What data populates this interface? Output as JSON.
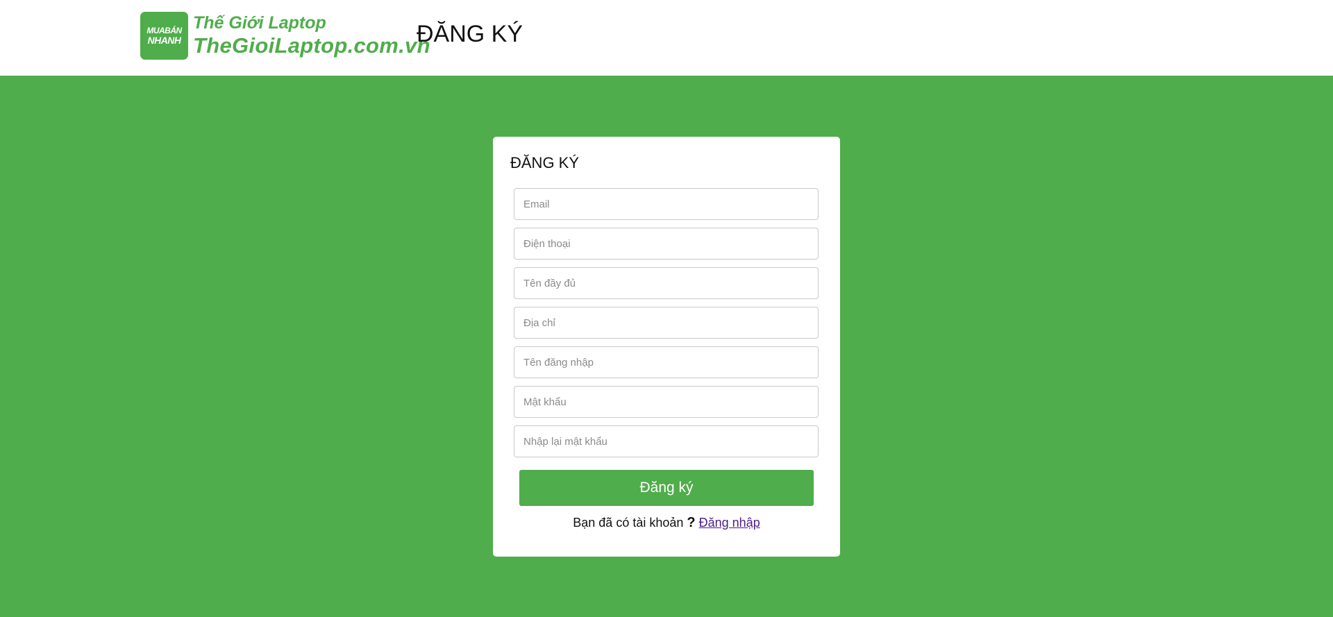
{
  "header": {
    "logo": {
      "badge_line1": "MUABÁN",
      "badge_line2": "NHANH",
      "line1": "Thế Giới Laptop",
      "line2": "TheGioiLaptop.com.vn"
    },
    "title": "ĐĂNG KÝ"
  },
  "form": {
    "title": "ĐĂNG KÝ",
    "fields": {
      "email": "Email",
      "phone": "Điện thoại",
      "fullname": "Tên đầy đủ",
      "address": "Địa chỉ",
      "username": "Tên đăng nhập",
      "password": "Mật khẩu",
      "confirm_password": "Nhập lại mật khẩu"
    },
    "submit_label": "Đăng ký",
    "login_prompt": "Bạn đã có tài khoản",
    "login_prompt_mark": "?",
    "login_link": "Đăng nhập"
  },
  "colors": {
    "brand_green": "#4fad4b",
    "link": "#4b1d8c"
  }
}
